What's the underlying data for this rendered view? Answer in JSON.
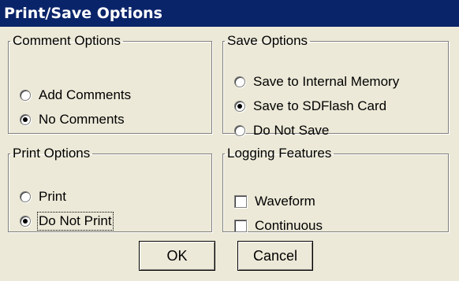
{
  "window": {
    "title": "Print/Save Options"
  },
  "comment_options": {
    "legend": "Comment Options",
    "options": [
      {
        "label": "Add Comments",
        "checked": false
      },
      {
        "label": "No Comments",
        "checked": true
      }
    ]
  },
  "save_options": {
    "legend": "Save Options",
    "options": [
      {
        "label": "Save to Internal Memory",
        "checked": false
      },
      {
        "label": "Save to SDFlash Card",
        "checked": true
      },
      {
        "label": "Do Not Save",
        "checked": false
      }
    ]
  },
  "print_options": {
    "legend": "Print Options",
    "options": [
      {
        "label": "Print",
        "checked": false
      },
      {
        "label": "Do Not Print",
        "checked": true
      }
    ]
  },
  "logging_features": {
    "legend": "Logging Features",
    "options": [
      {
        "label": "Waveform",
        "checked": false
      },
      {
        "label": "Continuous",
        "checked": false
      }
    ]
  },
  "buttons": {
    "ok": "OK",
    "cancel": "Cancel"
  }
}
